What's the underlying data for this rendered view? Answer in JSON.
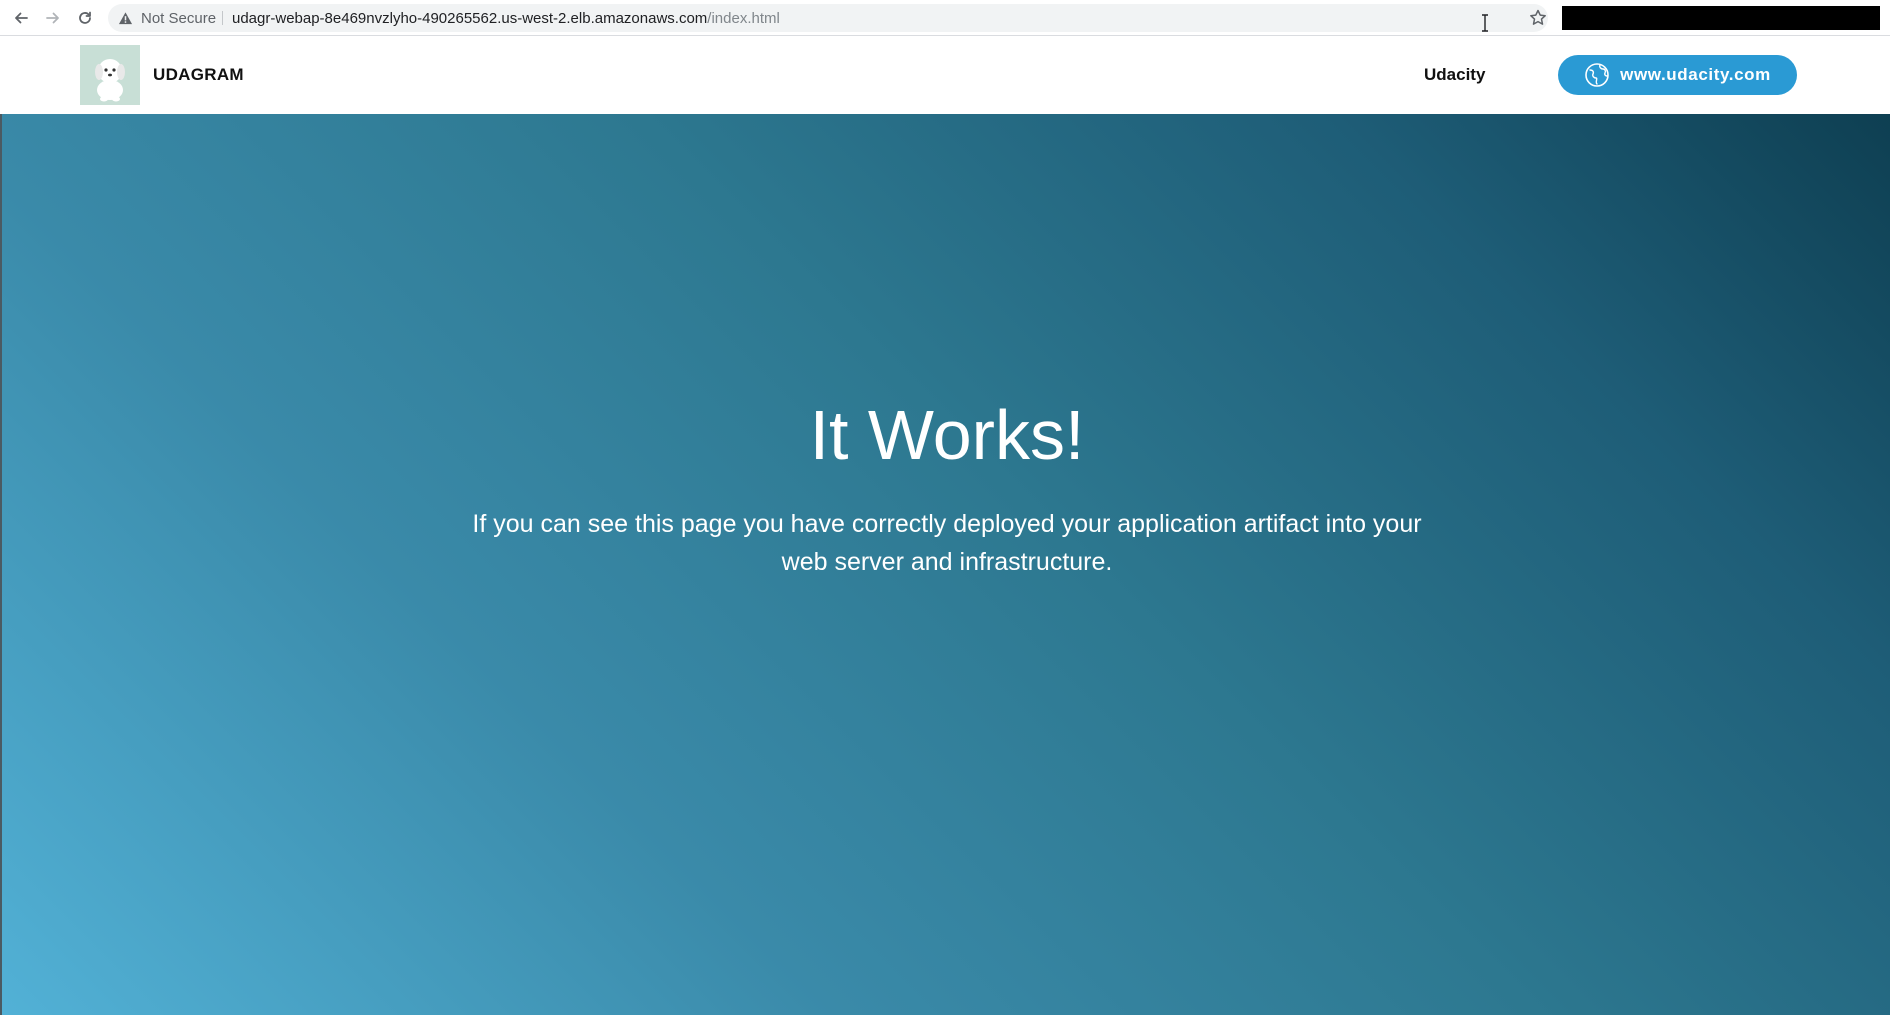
{
  "browser": {
    "security_label": "Not Secure",
    "url_host": "udagr-webap-8e469nvzlyho-490265562.us-west-2.elb.amazonaws.com",
    "url_path": "/index.html",
    "icons": [
      "back-arrow-icon",
      "forward-arrow-icon",
      "reload-icon",
      "warning-icon",
      "text-cursor-icon",
      "star-icon"
    ]
  },
  "header": {
    "brand": "UDAGRAM",
    "nav_link": "Udacity",
    "button_label": "www.udacity.com",
    "button_icon": "globe-icon",
    "logo_icon": "dog-logo-icon"
  },
  "hero": {
    "title": "It Works!",
    "text": "If you can see this page you have correctly deployed your application artifact into your web server and infrastructure."
  },
  "colors": {
    "button": "#2a9ad4",
    "hero_light": "#52b1d6",
    "hero_dark": "#0e3f52",
    "logo_bg": "#c8dfd6"
  }
}
